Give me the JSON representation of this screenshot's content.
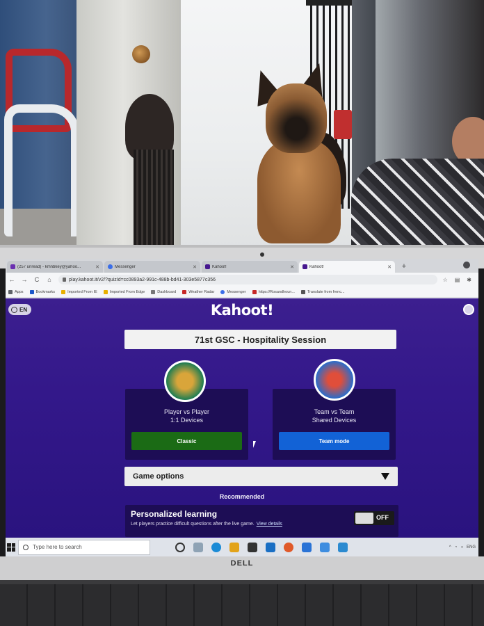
{
  "browser": {
    "tabs": [
      {
        "label": "(257 unread) - kmnbkey@yahoo...",
        "fav_color": "#6a2fb0",
        "active": false
      },
      {
        "label": "Messenger",
        "fav_color": "#3b6ee8",
        "active": false
      },
      {
        "label": "Kahoot!",
        "fav_color": "#46178f",
        "active": false
      },
      {
        "label": "Kahoot!",
        "fav_color": "#46178f",
        "active": true
      }
    ],
    "new_tab_symbol": "+",
    "url": "play.kahoot.it/v2/?quizId=cc0893a2-991c-488b-bd41-303e5877c356",
    "bookmarks": [
      {
        "label": "Apps",
        "color": "#5f6368"
      },
      {
        "label": "Bookmarks",
        "color": "#1a56c9"
      },
      {
        "label": "Imported From IE",
        "color": "#e8b000"
      },
      {
        "label": "Imported From Edge",
        "color": "#e8b000"
      },
      {
        "label": "Dashboard",
        "color": "#777777"
      },
      {
        "label": "Weather Radar",
        "color": "#c62828"
      },
      {
        "label": "Messenger",
        "color": "#3b6ee8"
      },
      {
        "label": "https://Rosandhoun...",
        "color": "#c62828"
      },
      {
        "label": "Translate from frenc...",
        "color": "#555555"
      }
    ]
  },
  "kahoot": {
    "lang": "EN",
    "logo": "Kahoot!",
    "quiz_title": "71st GSC - Hospitality Session",
    "modes": [
      {
        "title": "Player vs Player",
        "subtitle": "1:1 Devices",
        "button": "Classic",
        "button_color": "#1b6b15"
      },
      {
        "title": "Team vs Team",
        "subtitle": "Shared Devices",
        "button": "Team mode",
        "button_color": "#1262d6"
      }
    ],
    "game_options": "Game options",
    "recommended": "Recommended",
    "personalized": {
      "title": "Personalized learning",
      "description": "Let players practice difficult questions after the live game.",
      "link": "View details",
      "toggle": "OFF"
    }
  },
  "taskbar": {
    "search_placeholder": "Type here to search",
    "tray_lang": "ENG"
  },
  "laptop": {
    "brand": "DELL"
  }
}
